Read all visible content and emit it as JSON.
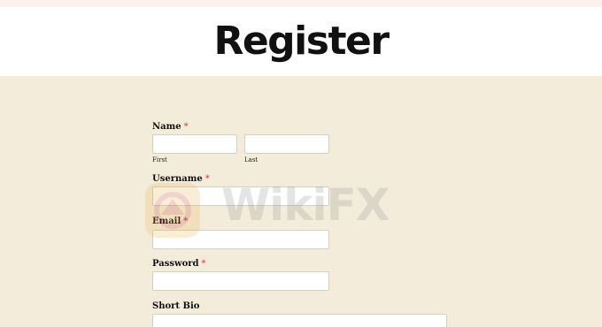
{
  "page": {
    "title": "Register"
  },
  "form": {
    "name": {
      "label": "Name",
      "required_mark": "*",
      "first_sublabel": "First",
      "last_sublabel": "Last",
      "first_value": "",
      "last_value": ""
    },
    "username": {
      "label": "Username",
      "required_mark": "*",
      "value": ""
    },
    "email": {
      "label": "Email",
      "required_mark": "*",
      "value": ""
    },
    "password": {
      "label": "Password",
      "required_mark": "*",
      "value": ""
    },
    "short_bio": {
      "label": "Short Bio",
      "value": ""
    }
  },
  "watermark": {
    "text": "WikiFX",
    "icon": "wikifx-logo-icon"
  },
  "colors": {
    "background": "#f4ecdb",
    "header_bg": "#ffffff",
    "required": "#d63638",
    "title": "#111111"
  }
}
